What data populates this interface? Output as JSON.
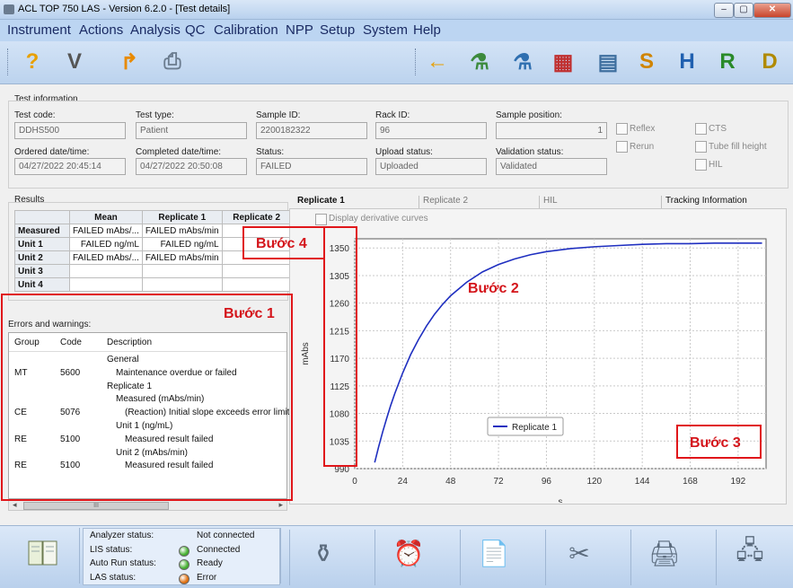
{
  "window": {
    "title": "ACL TOP 750 LAS - Version 6.2.0 - [Test details]",
    "buttons": {
      "minimize": "–",
      "restore": "▢",
      "close": "✕"
    }
  },
  "menu": [
    "Instrument",
    "Actions",
    "Analysis",
    "QC",
    "Calibration",
    "NPP",
    "Setup",
    "System",
    "Help"
  ],
  "toolbar": {
    "left": [
      {
        "glyph": "?",
        "color": "#e8a000",
        "name": "help-icon"
      },
      {
        "glyph": "V",
        "color": "#555555",
        "name": "validate-icon"
      },
      {
        "glyph": "↱",
        "color": "#e88a00",
        "name": "redo-arrow-icon"
      },
      {
        "glyph": "⎙",
        "color": "#6b7c8f",
        "name": "printer-icon"
      }
    ],
    "right": [
      {
        "glyph": "←",
        "color": "#e8a000",
        "name": "back-arrow-icon"
      },
      {
        "glyph": "⚗",
        "color": "#3c8a3c",
        "name": "rerun-icon"
      },
      {
        "glyph": "⚗",
        "color": "#2f6fb0",
        "name": "rerun-sample-icon"
      },
      {
        "glyph": "▦",
        "color": "#c03030",
        "name": "graph-icon"
      },
      {
        "glyph": "▤",
        "color": "#3f6f9f",
        "name": "report-icon"
      },
      {
        "glyph": "S",
        "color": "#d08400",
        "name": "s-tube-icon"
      },
      {
        "glyph": "H",
        "color": "#2060b0",
        "name": "h-tube-icon"
      },
      {
        "glyph": "R",
        "color": "#2a8a2a",
        "name": "r-tube-icon"
      },
      {
        "glyph": "D",
        "color": "#b08a00",
        "name": "d-tube-icon"
      }
    ]
  },
  "test_info": {
    "section": "Test information",
    "fields": [
      {
        "label": "Test code:",
        "value": "DDHS500"
      },
      {
        "label": "Test type:",
        "value": "Patient"
      },
      {
        "label": "Sample ID:",
        "value": "2200182322"
      },
      {
        "label": "Rack ID:",
        "value": "96"
      },
      {
        "label": "Sample position:",
        "value": "1"
      },
      {
        "label": "Ordered date/time:",
        "value": "04/27/2022 20:45:14"
      },
      {
        "label": "Completed date/time:",
        "value": "04/27/2022 20:50:08"
      },
      {
        "label": "Status:",
        "value": "FAILED"
      },
      {
        "label": "Upload status:",
        "value": "Uploaded"
      },
      {
        "label": "Validation status:",
        "value": "Validated"
      }
    ],
    "checkboxes": [
      "Reflex",
      "Rerun",
      "CTS",
      "Tube fill height",
      "HIL"
    ]
  },
  "results": {
    "section": "Results",
    "columns": [
      "",
      "Mean",
      "Replicate 1",
      "Replicate 2"
    ],
    "rows": [
      [
        "Measured",
        "FAILED mAbs/...",
        "FAILED mAbs/min",
        ""
      ],
      [
        "Unit 1",
        "FAILED ng/mL",
        "FAILED ng/mL",
        ""
      ],
      [
        "Unit 2",
        "FAILED mAbs/...",
        "FAILED mAbs/min",
        ""
      ],
      [
        "Unit 3",
        "",
        "",
        ""
      ],
      [
        "Unit 4",
        "",
        "",
        ""
      ]
    ]
  },
  "errors": {
    "section": "Errors and warnings:",
    "columns": [
      "Group",
      "Code",
      "Description"
    ],
    "rows": [
      {
        "group": "",
        "code": "",
        "desc": "General",
        "indent": 0
      },
      {
        "group": "MT",
        "code": "5600",
        "desc": "Maintenance overdue or failed",
        "indent": 1
      },
      {
        "group": "",
        "code": "",
        "desc": "Replicate 1",
        "indent": 0
      },
      {
        "group": "",
        "code": "",
        "desc": "Measured (mAbs/min)",
        "indent": 1
      },
      {
        "group": "CE",
        "code": "5076",
        "desc": "(Reaction) Initial slope exceeds error limit",
        "indent": 2
      },
      {
        "group": "",
        "code": "",
        "desc": "Unit 1 (ng/mL)",
        "indent": 1
      },
      {
        "group": "RE",
        "code": "5100",
        "desc": "Measured result failed",
        "indent": 2
      },
      {
        "group": "",
        "code": "",
        "desc": "Unit 2 (mAbs/min)",
        "indent": 1
      },
      {
        "group": "RE",
        "code": "5100",
        "desc": "Measured result failed",
        "indent": 2
      }
    ],
    "scroll_thumb": "III"
  },
  "tabs": [
    "Replicate 1",
    "Replicate 2",
    "HIL",
    "Tracking Information"
  ],
  "derivative_label": "Display derivative curves",
  "chart_data": {
    "type": "line",
    "xlabel": "s",
    "ylabel": "mAbs",
    "xlim": [
      0,
      206
    ],
    "ylim": [
      990,
      1365
    ],
    "xticks": [
      0,
      24,
      48,
      72,
      96,
      120,
      144,
      168,
      192
    ],
    "yticks": [
      990,
      1035,
      1080,
      1125,
      1170,
      1215,
      1260,
      1305,
      1350
    ],
    "legend": "center",
    "grid": true,
    "series": [
      {
        "name": "Replicate 1",
        "color": "#1f2fc0",
        "x": [
          10,
          12,
          14,
          16,
          18,
          20,
          24,
          28,
          32,
          36,
          40,
          44,
          48,
          56,
          64,
          72,
          80,
          88,
          96,
          108,
          120,
          132,
          144,
          156,
          168,
          180,
          192,
          204
        ],
        "y": [
          1000,
          1026,
          1050,
          1072,
          1093,
          1112,
          1146,
          1176,
          1201,
          1223,
          1242,
          1258,
          1272,
          1294,
          1311,
          1323,
          1332,
          1339,
          1344,
          1349,
          1352,
          1354,
          1356,
          1357,
          1357,
          1358,
          1358,
          1358
        ]
      }
    ]
  },
  "annotations": [
    "Bước 1",
    "Bước 2",
    "Bước 3",
    "Bước 4"
  ],
  "status": [
    {
      "label": "Analyzer status:",
      "value": "Not connected",
      "led": ""
    },
    {
      "label": "LIS status:",
      "value": "Connected",
      "led": "#45b030"
    },
    {
      "label": "Auto Run status:",
      "value": "Ready",
      "led": "#45b030"
    },
    {
      "label": "LAS status:",
      "value": "Error",
      "led": "#e07010"
    }
  ],
  "bottom_icons": [
    {
      "name": "manual-book-icon",
      "glyph": "📖"
    },
    {
      "name": "reagent-bottle-icon",
      "glyph": "⚱"
    },
    {
      "name": "maintenance-alarm-icon",
      "glyph": "⏰"
    },
    {
      "name": "report-sheet-icon",
      "glyph": "📄"
    },
    {
      "name": "tools-icon",
      "glyph": "✂"
    },
    {
      "name": "printer-tray-icon",
      "glyph": "🖨"
    },
    {
      "name": "network-computer-icon",
      "glyph": "🖧"
    }
  ]
}
